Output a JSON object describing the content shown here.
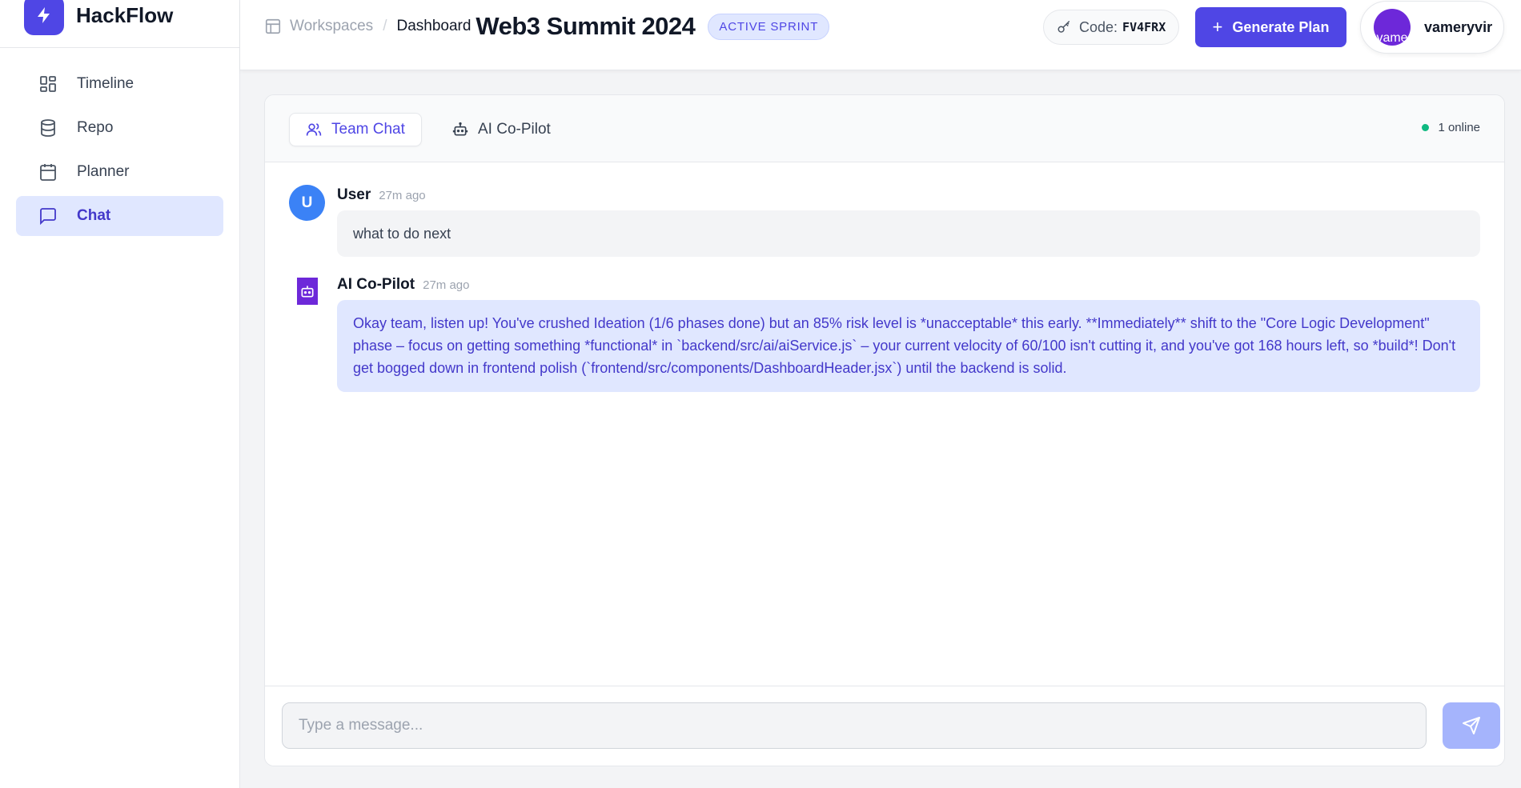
{
  "app": {
    "name": "HackFlow",
    "accent": "#4f46e5"
  },
  "sidebar": {
    "items": [
      {
        "label": "Timeline",
        "icon": "grid-icon"
      },
      {
        "label": "Repo",
        "icon": "database-icon"
      },
      {
        "label": "Planner",
        "icon": "calendar-icon"
      },
      {
        "label": "Chat",
        "icon": "chat-icon",
        "active": true
      }
    ]
  },
  "header": {
    "breadcrumb": {
      "root": "Workspaces",
      "separator": "/",
      "current": "Dashboard"
    },
    "title": "Web3 Summit 2024",
    "badge": "ACTIVE SPRINT",
    "code_label": "Code:",
    "code_value": "FV4FRX",
    "generate_label": "Generate Plan",
    "user": {
      "name": "vameryvir",
      "avatar_alt": "vame"
    }
  },
  "chat": {
    "tabs": [
      {
        "label": "Team Chat",
        "icon": "users-icon",
        "active": true
      },
      {
        "label": "AI Co-Pilot",
        "icon": "bot-icon"
      }
    ],
    "online": "1 online",
    "messages": [
      {
        "avatar": "U",
        "author": "User",
        "time": "27m ago",
        "text": "what to do next"
      },
      {
        "author": "AI Co-Pilot",
        "time": "27m ago",
        "text": "Okay team, listen up! You've crushed Ideation (1/6 phases done) but an 85% risk level is *unacceptable* this early. **Immediately** shift to the \"Core Logic Development\" phase – focus on getting something *functional* in `backend/src/ai/aiService.js` – your current velocity of 60/100 isn't cutting it, and you've got 168 hours left, so *build*! Don't get bogged down in frontend polish (`frontend/src/components/DashboardHeader.jsx`) until the backend is solid."
      }
    ],
    "input_placeholder": "Type a message..."
  }
}
